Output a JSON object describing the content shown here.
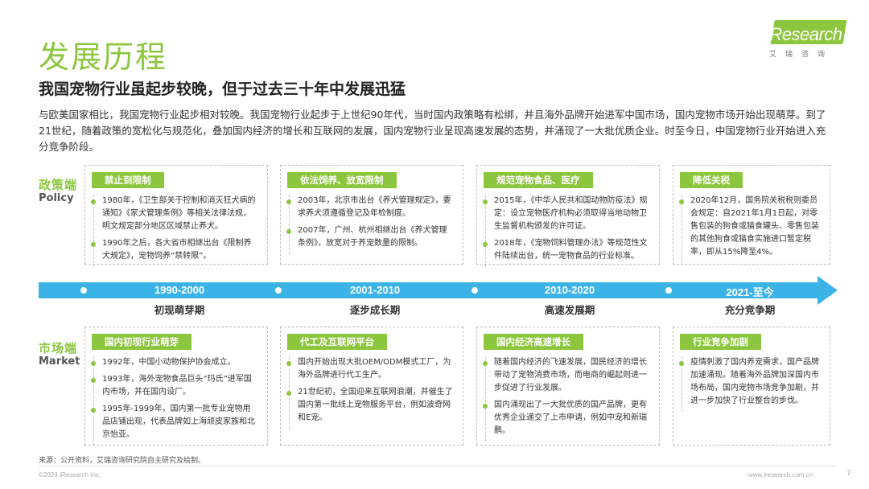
{
  "header": {
    "title": "发展历程",
    "subtitle": "我国宠物行业虽起步较晚，但于过去三十年中发展迅猛",
    "intro": "与欧美国家相比，我国宠物行业起步相对较晚。我国宠物行业起步于上世纪90年代，当时国内政策略有松绑，并且海外品牌开始进军中国市场，国内宠物市场开始出现萌芽。到了21世纪，随着政策的宽松化与规范化，叠加国内经济的增长和互联网的发展，国内宠物行业呈现高速发展的态势，并涌现了一大批优质企业。时至今日，中国宠物行业开始进入充分竞争阶段。"
  },
  "logo": {
    "wordmark_i": "i",
    "wordmark_rest": "Research",
    "cn": "艾瑞咨询",
    "brand_color": "#8cc63e"
  },
  "labels": {
    "policy_cn": "政策端",
    "policy_en": "Policy",
    "market_cn": "市场端",
    "market_en": "Market"
  },
  "timeline": {
    "color": "#3bb3e6",
    "periods": [
      {
        "range": "1990-2000",
        "stage": "初现萌芽期"
      },
      {
        "range": "2001-2010",
        "stage": "逐步成长期"
      },
      {
        "range": "2010-2020",
        "stage": "高速发展期"
      },
      {
        "range": "2021-至今",
        "stage": "充分竞争期"
      }
    ]
  },
  "policy_cards": [
    {
      "tag": "禁止到限制",
      "entries": [
        "1980年，《卫生部关于控制和消灭狂犬病的通知》《家犬管理条例》等相关法律法规，明文规定部分地区区域禁止养犬。",
        "1990年之后，各大省市相继出台《限制养犬规定》，宠物饲养“禁转限”。"
      ]
    },
    {
      "tag": "依法饲养、放宽限制",
      "entries": [
        "2003年，北京市出台《养犬管理规定》，要求养犬须遵循登记及年检制度。",
        "2007年，广州、杭州相继出台《养犬管理条例》，放宽对于养宠数量的限制。"
      ]
    },
    {
      "tag": "规范宠物食品、医疗",
      "entries": [
        "2015年，《中华人民共和国动物防疫法》规定：设立宠物医疗机构必须取得当地动物卫生监督机构颁发的许可证。",
        "2018年，《宠物饲料管理办法》等规范性文件陆续出台，统一宠物食品的行业标准。"
      ]
    },
    {
      "tag": "降低关税",
      "entries": [
        "2020年12月，国务院关税税则委员会规定：自2021年1月1日起，对零售包装的狗食或猫食罐头、零售包装的其他狗食或猫食实施进口暂定税率，即从15%降至4%。"
      ]
    }
  ],
  "market_cards": [
    {
      "tag": "国内初现行业萌芽",
      "entries": [
        "1992年，中国小动物保护协会成立。",
        "1993年，海外宠物食品巨头“玛氏”进军国内市场，并在国内设厂。",
        "1995年-1999年，国内第一批专业宠物用品店铺出现，代表品牌如上海顽皮家族和北京怡亚。"
      ]
    },
    {
      "tag": "代工及互联网平台",
      "entries": [
        "国内开始出现大批OEM/ODM模式工厂，为海外品牌进行代工生产。",
        "21世纪初，全国迎来互联网浪潮，并催生了国内第一批线上宠物服务平台，例如波奇网和E宠。"
      ]
    },
    {
      "tag": "国内经济高速增长",
      "entries": [
        "随着国内经济的飞速发展，国民经济的增长带动了宠物消费市场，而电商的崛起则进一步促进了行业发展。",
        "国内涌现出了一大批优质的国产品牌，更有优秀企业递交了上市申请，例如中宠和新瑞鹏。"
      ]
    },
    {
      "tag": "行业竞争加剧",
      "entries": [
        "疫情刺激了国内养宠需求，国产品牌加速涌现。随着海外品牌加深国内市场布局，国内宠物市场竞争加剧，并进一步加快了行业整合的步伐。"
      ]
    }
  ],
  "footer": {
    "source": "来源：公开资料，艾瑞咨询研究院自主研究及绘制。",
    "copyright": "©2024 iResearch Inc.",
    "website": "www.iresearch.com.cn",
    "page": "7"
  }
}
